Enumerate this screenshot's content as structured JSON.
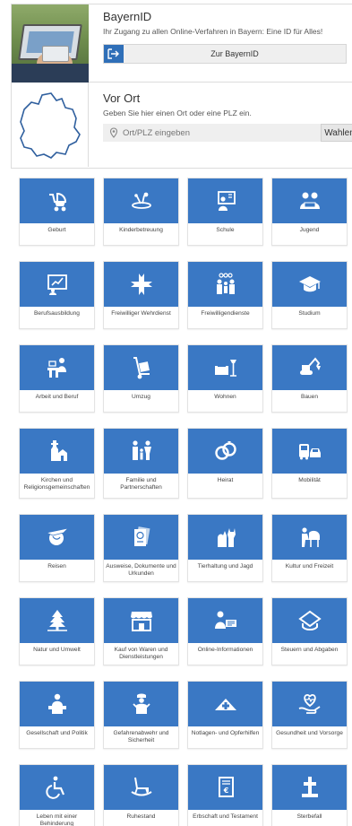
{
  "bayernid": {
    "title": "BayernID",
    "subtitle": "Ihr Zugang zu allen Online-Verfahren in Bayern: Eine ID für Alles!",
    "button_label": "Zur BayernID",
    "button_icon": "login-arrow-icon"
  },
  "vorort": {
    "title": "Vor Ort",
    "subtitle": "Geben Sie hier einen Ort oder eine PLZ ein.",
    "search_placeholder": "Ort/PLZ eingeben",
    "search_value": "",
    "button_label": "Wahlen"
  },
  "colors": {
    "tile_blue": "#3a78c4",
    "button_blue": "#2f6fb8"
  },
  "tiles": [
    {
      "label": "Geburt",
      "icon": "stroller-icon"
    },
    {
      "label": "Kinderbetreuung",
      "icon": "playground-icon"
    },
    {
      "label": "Schule",
      "icon": "blackboard-icon"
    },
    {
      "label": "Jugend",
      "icon": "youth-icon"
    },
    {
      "label": "Berufsausbildung",
      "icon": "presentation-icon"
    },
    {
      "label": "Freiwilliger Wehrdienst",
      "icon": "cross-emblem-icon"
    },
    {
      "label": "Freiwilligendienste",
      "icon": "volunteers-icon"
    },
    {
      "label": "Studium",
      "icon": "graduation-cap-icon"
    },
    {
      "label": "Arbeit und Beruf",
      "icon": "office-desk-icon"
    },
    {
      "label": "Umzug",
      "icon": "hand-truck-icon"
    },
    {
      "label": "Wohnen",
      "icon": "armchair-lamp-icon"
    },
    {
      "label": "Bauen",
      "icon": "excavator-icon"
    },
    {
      "label": "Kirchen und Religionsgemeinschaften",
      "icon": "church-icon"
    },
    {
      "label": "Familie und Partnerschaften",
      "icon": "family-icon"
    },
    {
      "label": "Heirat",
      "icon": "rings-icon"
    },
    {
      "label": "Mobilität",
      "icon": "bus-car-icon"
    },
    {
      "label": "Reisen",
      "icon": "plane-globe-icon"
    },
    {
      "label": "Ausweise, Dokumente und Urkunden",
      "icon": "passport-icon"
    },
    {
      "label": "Tierhaltung und Jagd",
      "icon": "pets-icon"
    },
    {
      "label": "Kultur und Freizeit",
      "icon": "piano-icon"
    },
    {
      "label": "Natur und Umwelt",
      "icon": "tree-icon"
    },
    {
      "label": "Kauf von Waren und Dienstleistungen",
      "icon": "shop-icon"
    },
    {
      "label": "Online-Informationen",
      "icon": "user-computer-icon"
    },
    {
      "label": "Steuern und Abgaben",
      "icon": "tax-hat-icon"
    },
    {
      "label": "Gesellschaft und Politik",
      "icon": "speaker-podium-icon"
    },
    {
      "label": "Gefahrenabwehr und Sicherheit",
      "icon": "safety-person-icon"
    },
    {
      "label": "Notlagen- und Opferhilfen",
      "icon": "aid-tent-icon"
    },
    {
      "label": "Gesundheit und Vorsorge",
      "icon": "heart-hand-icon"
    },
    {
      "label": "Leben mit einer Behinderung",
      "icon": "wheelchair-icon"
    },
    {
      "label": "Ruhestand",
      "icon": "rocking-chair-icon"
    },
    {
      "label": "Erbschaft und Testament",
      "icon": "testament-icon"
    },
    {
      "label": "Sterbefall",
      "icon": "grave-cross-icon"
    }
  ]
}
